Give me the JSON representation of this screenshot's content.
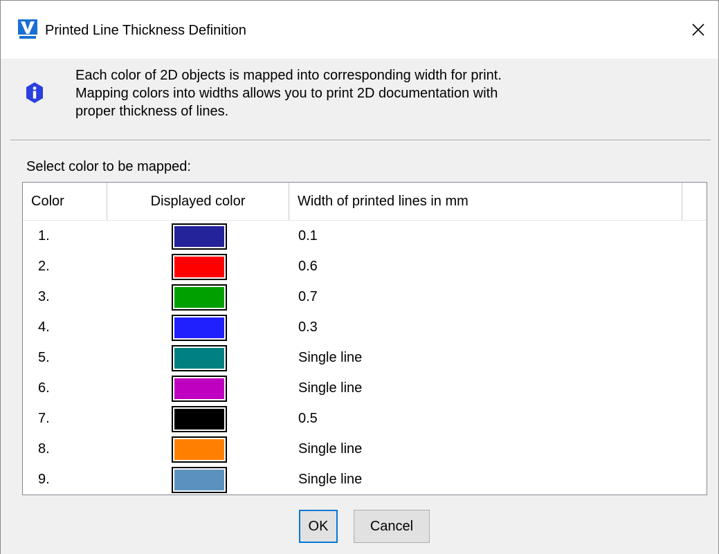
{
  "window": {
    "title": "Printed Line Thickness Definition",
    "close_glyph": "✕",
    "app_icon": "vectorcad-logo-icon"
  },
  "info": {
    "icon": "info-icon",
    "lines": [
      "Each color of 2D objects is mapped into corresponding width for print.",
      "Mapping colors into widths allows you to print 2D documentation with",
      "proper thickness of lines."
    ]
  },
  "select_label": "Select color to be mapped:",
  "table": {
    "headers": {
      "color": "Color",
      "displayed_color": "Displayed color",
      "width": "Width of printed lines in mm"
    },
    "rows": [
      {
        "num": "1.",
        "color": "#25239a",
        "width": "0.1"
      },
      {
        "num": "2.",
        "color": "#ff0000",
        "width": "0.6"
      },
      {
        "num": "3.",
        "color": "#00a000",
        "width": "0.7"
      },
      {
        "num": "4.",
        "color": "#2020ff",
        "width": "0.3"
      },
      {
        "num": "5.",
        "color": "#008080",
        "width": "Single line"
      },
      {
        "num": "6.",
        "color": "#c000c0",
        "width": "Single line"
      },
      {
        "num": "7.",
        "color": "#000000",
        "width": "0.5"
      },
      {
        "num": "8.",
        "color": "#ff8000",
        "width": "Single line"
      },
      {
        "num": "9.",
        "color": "#5a92be",
        "width": "Single line"
      }
    ]
  },
  "buttons": {
    "ok": "OK",
    "cancel": "Cancel"
  },
  "colors": {
    "info_icon": "#2b3fe0",
    "focus_border": "#0078d7"
  }
}
